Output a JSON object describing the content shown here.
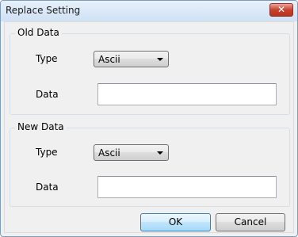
{
  "window": {
    "title": "Replace Setting",
    "close_icon": "close-icon"
  },
  "old_data": {
    "group_title": "Old Data",
    "type_label": "Type",
    "type_value": "Ascii",
    "data_label": "Data",
    "data_value": ""
  },
  "new_data": {
    "group_title": "New Data",
    "type_label": "Type",
    "type_value": "Ascii",
    "data_label": "Data",
    "data_value": ""
  },
  "buttons": {
    "ok": "OK",
    "cancel": "Cancel"
  },
  "colors": {
    "close_button": "#c8412f",
    "ok_border": "#3c7fb1"
  }
}
